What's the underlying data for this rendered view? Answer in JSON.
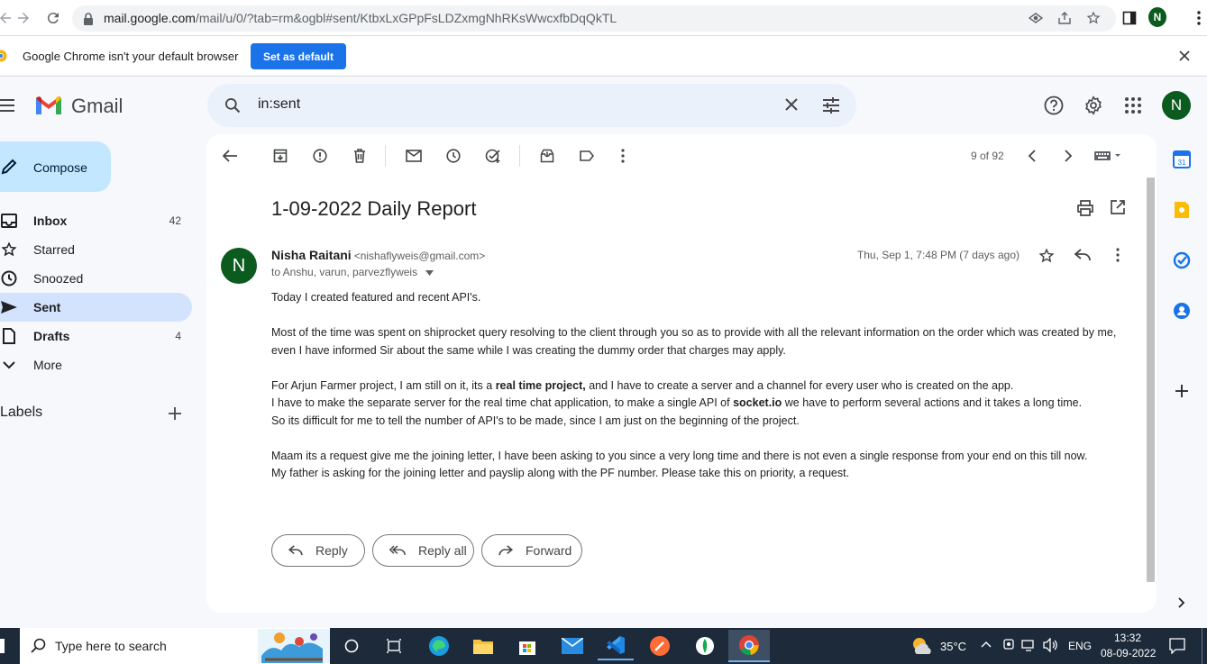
{
  "browser": {
    "url_host": "mail.google.com",
    "url_path": "/mail/u/0/?tab=rm&ogbl#sent/KtbxLxGPpFsLDZxmgNhRKsWwcxfbDqQkTL",
    "profile_initial": "N"
  },
  "infobar": {
    "message": "Google Chrome isn't your default browser",
    "button": "Set as default"
  },
  "gmail": {
    "logo_text": "Gmail",
    "search_value": "in:sent",
    "account_initial": "N"
  },
  "sidebar": {
    "compose": "Compose",
    "items": [
      {
        "label": "Inbox",
        "count": "42",
        "icon": "inbox-icon"
      },
      {
        "label": "Starred",
        "count": "",
        "icon": "star-icon"
      },
      {
        "label": "Snoozed",
        "count": "",
        "icon": "clock-icon"
      },
      {
        "label": "Sent",
        "count": "",
        "icon": "send-icon"
      },
      {
        "label": "Drafts",
        "count": "4",
        "icon": "draft-icon"
      },
      {
        "label": "More",
        "count": "",
        "icon": "chevron-down-icon"
      }
    ],
    "labels_heading": "Labels"
  },
  "toolbar": {
    "pagination": "9 of 92"
  },
  "email": {
    "subject": "1-09-2022 Daily Report",
    "sender_initial": "N",
    "sender_name": "Nisha Raitani",
    "sender_email": "<nishaflyweis@gmail.com>",
    "recipients": "to Anshu, varun, parvezflyweis",
    "date": "Thu, Sep 1, 7:48 PM (7 days ago)",
    "body": {
      "p1": "Today I created featured and recent API's.",
      "p2": "Most of the time was spent on shiprocket query resolving to the client through you so as to provide with all the relevant information on the order which was created by me, even I have informed Sir about the same while I was creating the dummy order that charges may apply.",
      "p3a": "For Arjun Farmer project, I am still on it, its a ",
      "p3b": "real time project,",
      "p3c": " and I have to create a server and a channel for every user who is created on the app.",
      "p3d": "I have to make the separate server for the real time chat application, to make a single API of ",
      "p3e": "socket.io",
      "p3f": " we have to perform several actions and it takes a long time.",
      "p3g": "So its difficult for me to tell the number of API's to be made, since I am just on the beginning of the project.",
      "p4a": "Maam its a request give me the joining letter, I have been asking to you since a very long time and there is not even a single response from your end on this till now.",
      "p4b": "My father is asking for the joining letter and payslip along with the PF number. Please take this on priority, a request."
    },
    "reply": "Reply",
    "reply_all": "Reply all",
    "forward": "Forward"
  },
  "taskbar": {
    "search_placeholder": "Type here to search",
    "weather": "35°C",
    "language": "ENG",
    "time": "13:32",
    "date": "08-09-2022"
  }
}
